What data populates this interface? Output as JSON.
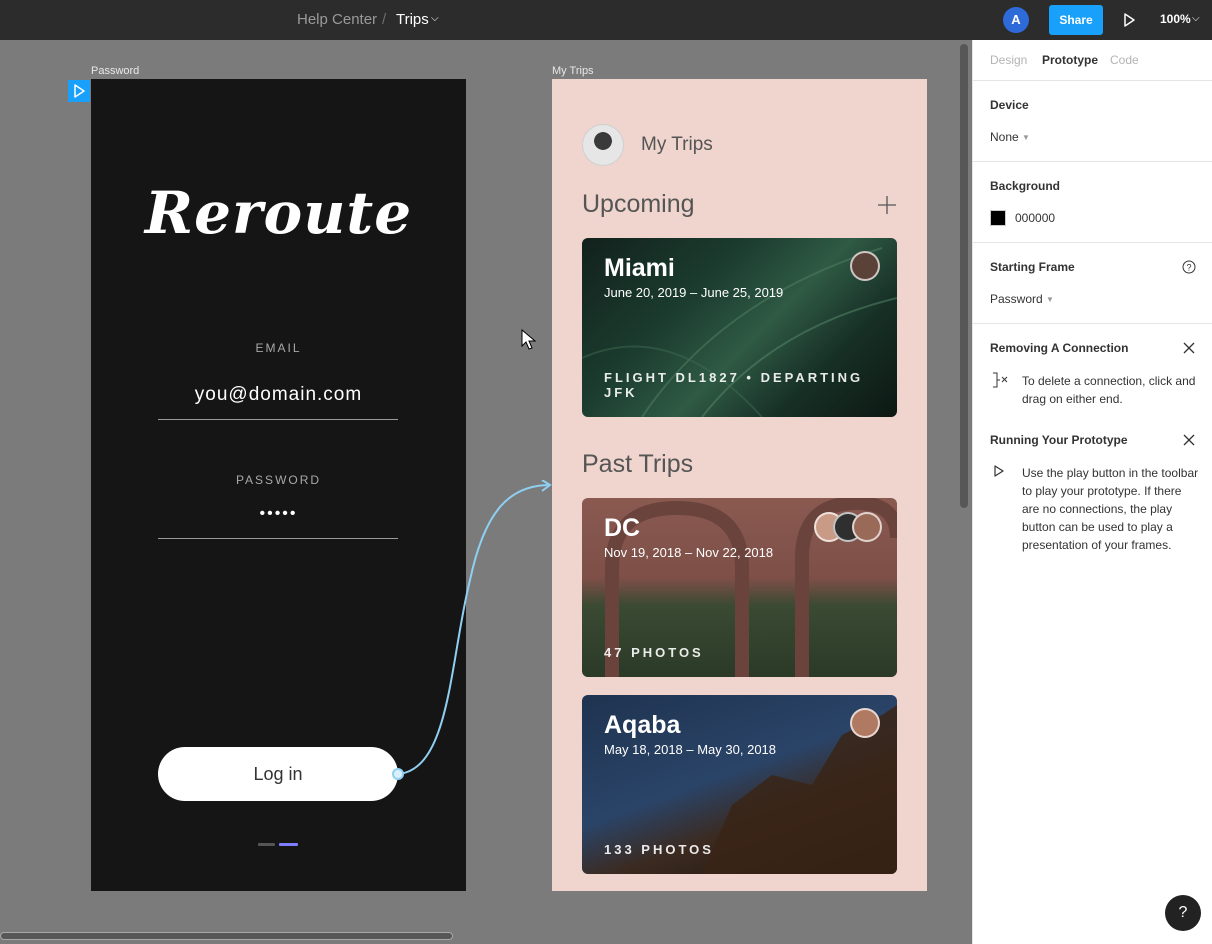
{
  "toolbar": {
    "breadcrumb_parent": "Help Center",
    "breadcrumb_separator": "/",
    "breadcrumb_current": "Trips",
    "avatar_initial": "A",
    "share_label": "Share",
    "zoom_level": "100%",
    "accent_color": "#18a0fb"
  },
  "canvas": {
    "password_frame": {
      "label": "Password",
      "logo": "Reroute",
      "email_label": "EMAIL",
      "email_value": "you@domain.com",
      "password_label": "PASSWORD",
      "password_value": "•••••",
      "login_label": "Log in"
    },
    "trips_frame": {
      "label": "My Trips",
      "title": "My Trips",
      "upcoming_title": "Upcoming",
      "past_title": "Past Trips",
      "cards": [
        {
          "title": "Miami",
          "dates": "June 20, 2019 – June 25, 2019",
          "footer": "FLIGHT DL1827 • DEPARTING JFK"
        },
        {
          "title": "DC",
          "dates": "Nov 19, 2018 – Nov 22, 2018",
          "footer": "47 PHOTOS"
        },
        {
          "title": "Aqaba",
          "dates": "May 18, 2018 – May 30, 2018",
          "footer": "133 PHOTOS"
        }
      ]
    }
  },
  "panel": {
    "tabs": [
      "Design",
      "Prototype",
      "Code"
    ],
    "active_tab": "Prototype",
    "device_title": "Device",
    "device_value": "None",
    "background_title": "Background",
    "background_value": "000000",
    "starting_frame_title": "Starting Frame",
    "starting_frame_value": "Password",
    "removing_title": "Removing A Connection",
    "removing_text": "To delete a connection, click and drag on either end.",
    "running_title": "Running Your Prototype",
    "running_text": "Use the play button in the toolbar to play your prototype. If there are no connections, the play button can be used to play a presentation of your frames.",
    "help_label": "?"
  }
}
